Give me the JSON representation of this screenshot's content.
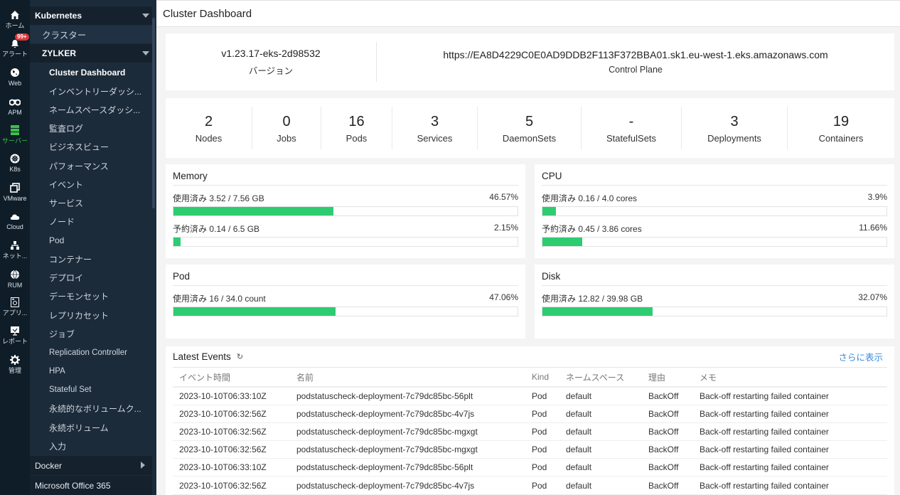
{
  "rail": {
    "items": [
      {
        "icon": "home-icon",
        "label": "ホーム"
      },
      {
        "icon": "bell-icon",
        "label": "アラート",
        "badge": "99+"
      },
      {
        "icon": "globe-icon",
        "label": "Web"
      },
      {
        "icon": "binoculars-icon",
        "label": "APM"
      },
      {
        "icon": "server-icon",
        "label": "サーバー",
        "active": true
      },
      {
        "icon": "kubernetes-icon",
        "label": "K8s"
      },
      {
        "icon": "vmware-icon",
        "label": "VMware"
      },
      {
        "icon": "cloud-icon",
        "label": "Cloud"
      },
      {
        "icon": "network-icon",
        "label": "ネット..."
      },
      {
        "icon": "rum-icon",
        "label": "RUM"
      },
      {
        "icon": "application-icon",
        "label": "アプリ..."
      },
      {
        "icon": "report-icon",
        "label": "レポート"
      },
      {
        "icon": "gear-icon",
        "label": "管理"
      }
    ]
  },
  "tree": {
    "kubernetes": "Kubernetes",
    "cluster": "クラスター",
    "zylker": "ZYLKER",
    "items": [
      "Cluster Dashboard",
      "インベントリーダッシ...",
      "ネームスペースダッシ...",
      "監査ログ",
      "ビジネスビュー",
      "パフォーマンス",
      "イベント",
      "サービス",
      "ノード",
      "Pod",
      "コンテナー",
      "デプロイ",
      "デーモンセット",
      "レプリカセット",
      "ジョブ",
      "Replication Controller",
      "HPA",
      "Stateful Set",
      "永続的なボリュームク...",
      "永続ボリューム",
      "入力"
    ],
    "docker": "Docker",
    "office": "Microsoft Office 365"
  },
  "header": {
    "title": "Cluster Dashboard"
  },
  "info": {
    "version_value": "v1.23.17-eks-2d98532",
    "version_label": "バージョン",
    "control_plane_value": "https://EA8D4229C0E0AD9DDB2F113F372BBA01.sk1.eu-west-1.eks.amazonaws.com",
    "control_plane_label": "Control Plane"
  },
  "counts": [
    {
      "value": "2",
      "label": "Nodes"
    },
    {
      "value": "0",
      "label": "Jobs"
    },
    {
      "value": "16",
      "label": "Pods"
    },
    {
      "value": "3",
      "label": "Services"
    },
    {
      "value": "5",
      "label": "DaemonSets"
    },
    {
      "value": "-",
      "label": "StatefulSets"
    },
    {
      "value": "3",
      "label": "Deployments"
    },
    {
      "value": "19",
      "label": "Containers"
    }
  ],
  "resources": {
    "memory": {
      "title": "Memory",
      "metrics": [
        {
          "label": "使用済み 3.52 / 7.56 GB",
          "percent_text": "46.57%",
          "percent": 46.57
        },
        {
          "label": "予約済み 0.14 / 6.5 GB",
          "percent_text": "2.15%",
          "percent": 2.15
        }
      ]
    },
    "cpu": {
      "title": "CPU",
      "metrics": [
        {
          "label": "使用済み 0.16 / 4.0 cores",
          "percent_text": "3.9%",
          "percent": 3.9
        },
        {
          "label": "予約済み 0.45 / 3.86 cores",
          "percent_text": "11.66%",
          "percent": 11.66
        }
      ]
    },
    "pod": {
      "title": "Pod",
      "metrics": [
        {
          "label": "使用済み 16 / 34.0 count",
          "percent_text": "47.06%",
          "percent": 47.06
        }
      ]
    },
    "disk": {
      "title": "Disk",
      "metrics": [
        {
          "label": "使用済み 12.82 / 39.98 GB",
          "percent_text": "32.07%",
          "percent": 32.07
        }
      ]
    }
  },
  "events": {
    "title": "Latest Events",
    "more_label": "さらに表示",
    "columns": [
      "イベント時間",
      "名前",
      "Kind",
      "ネームスペース",
      "理由",
      "メモ"
    ],
    "rows": [
      [
        "2023-10-10T06:33:10Z",
        "podstatuscheck-deployment-7c79dc85bc-56plt",
        "Pod",
        "default",
        "BackOff",
        "Back-off restarting failed container"
      ],
      [
        "2023-10-10T06:32:56Z",
        "podstatuscheck-deployment-7c79dc85bc-4v7js",
        "Pod",
        "default",
        "BackOff",
        "Back-off restarting failed container"
      ],
      [
        "2023-10-10T06:32:56Z",
        "podstatuscheck-deployment-7c79dc85bc-mgxgt",
        "Pod",
        "default",
        "BackOff",
        "Back-off restarting failed container"
      ],
      [
        "2023-10-10T06:32:56Z",
        "podstatuscheck-deployment-7c79dc85bc-mgxgt",
        "Pod",
        "default",
        "BackOff",
        "Back-off restarting failed container"
      ],
      [
        "2023-10-10T06:33:10Z",
        "podstatuscheck-deployment-7c79dc85bc-56plt",
        "Pod",
        "default",
        "BackOff",
        "Back-off restarting failed container"
      ],
      [
        "2023-10-10T06:32:56Z",
        "podstatuscheck-deployment-7c79dc85bc-4v7js",
        "Pod",
        "default",
        "BackOff",
        "Back-off restarting failed container"
      ]
    ]
  },
  "colors": {
    "bar_fill": "#2ecc71",
    "active_nav": "#3fbf4d",
    "link": "#3c8ad8",
    "alert_badge": "#e0363a"
  }
}
